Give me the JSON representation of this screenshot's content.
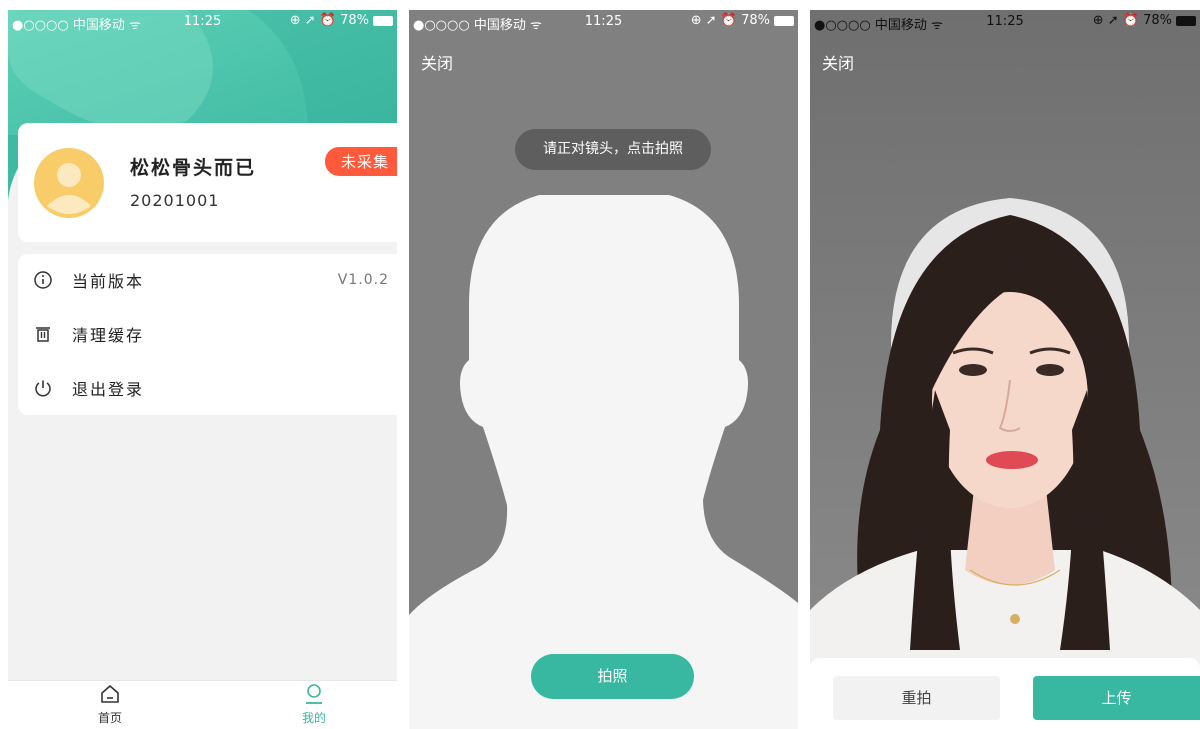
{
  "status_bar": {
    "carrier": "●○○○○ 中国移动 ᯤ",
    "time": "11:25",
    "right": "⊕ ➚ ⏰ 78%"
  },
  "profile_screen": {
    "user_name": "松松骨头而已",
    "user_id": "20201001",
    "badge": "未采集",
    "menu": [
      {
        "label": "当前版本",
        "value": "V1.0.2",
        "icon": "info-icon"
      },
      {
        "label": "清理缓存",
        "value": "",
        "icon": "trash-icon"
      },
      {
        "label": "退出登录",
        "value": "",
        "icon": "power-icon"
      }
    ],
    "tabs": [
      {
        "label": "首页",
        "icon": "home-icon",
        "active": false
      },
      {
        "label": "我的",
        "icon": "user-icon",
        "active": true
      }
    ]
  },
  "capture_screen": {
    "close_label": "关闭",
    "hint": "请正对镜头，点击拍照",
    "shoot_label": "拍照"
  },
  "preview_screen": {
    "close_label": "关闭",
    "retake_label": "重拍",
    "upload_label": "上传"
  },
  "colors": {
    "accent": "#38b8a0",
    "badge": "#ff5a3c",
    "tab_active": "#38b8a0",
    "tab_inactive": "#333333"
  }
}
